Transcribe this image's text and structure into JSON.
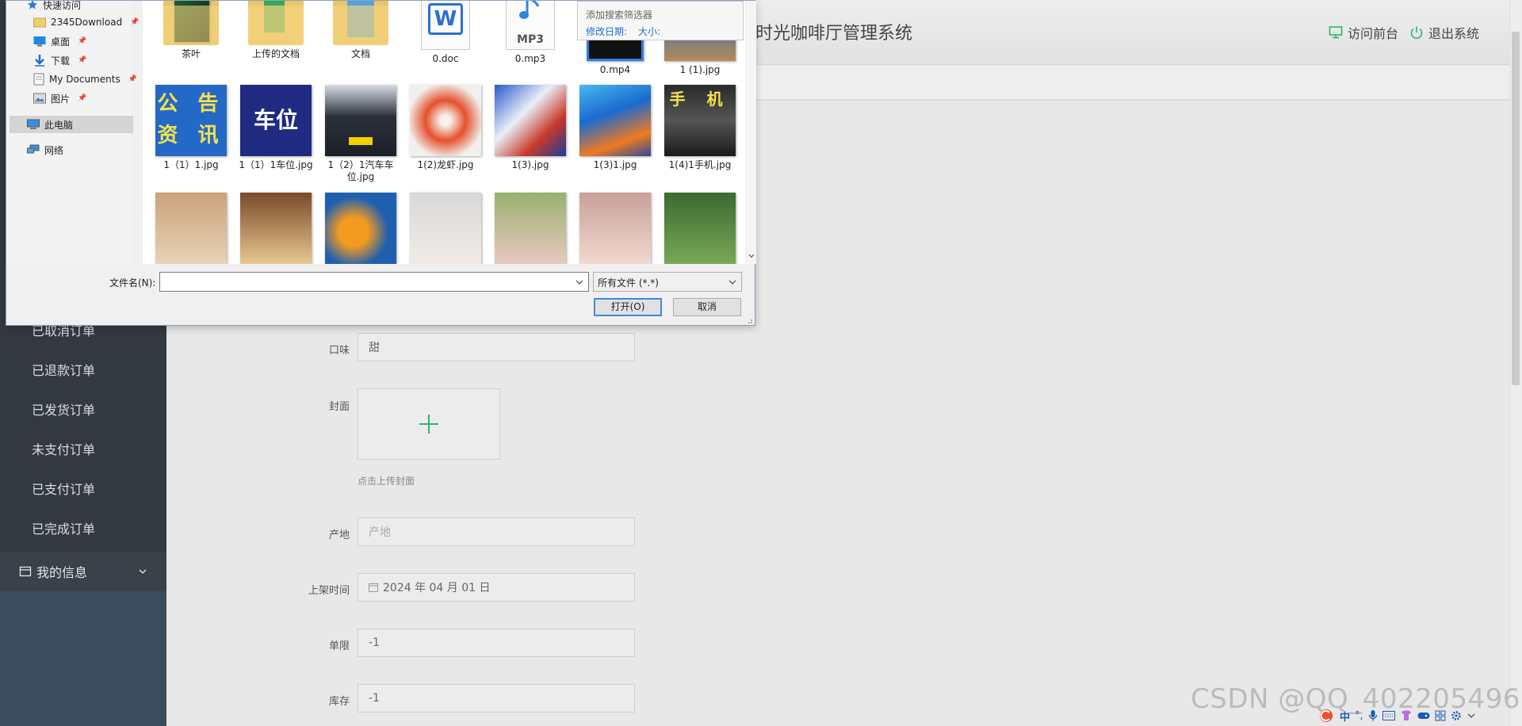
{
  "app": {
    "title": "时光咖啡厅管理系统",
    "visit_front": "访问前台",
    "logout": "退出系统"
  },
  "sidebar": {
    "items": [
      "已取消订单",
      "已退款订单",
      "已发货订单",
      "未支付订单",
      "已支付订单",
      "已完成订单"
    ],
    "group": "我的信息"
  },
  "form": {
    "taste": {
      "label": "口味",
      "value": "甜"
    },
    "cover": {
      "label": "封面",
      "hint": "点击上传封面"
    },
    "origin": {
      "label": "产地",
      "placeholder": "产地"
    },
    "shelf_time": {
      "label": "上架时间",
      "value": "2024 年 04 月 01 日"
    },
    "limit": {
      "label": "单限",
      "value": "-1"
    },
    "stock": {
      "label": "库存",
      "value": "-1"
    }
  },
  "dialog": {
    "nav": [
      {
        "label": "快速访问",
        "icon": "star-icon",
        "pinned": false
      },
      {
        "label": "2345Download",
        "icon": "folder-icon",
        "pinned": true
      },
      {
        "label": "桌面",
        "icon": "desktop-icon",
        "pinned": true
      },
      {
        "label": "下载",
        "icon": "download-icon",
        "pinned": true
      },
      {
        "label": "My Documents",
        "icon": "document-icon",
        "pinned": true
      },
      {
        "label": "图片",
        "icon": "pictures-icon",
        "pinned": true
      },
      {
        "label": "此电脑",
        "icon": "computer-icon",
        "pinned": false
      },
      {
        "label": "网络",
        "icon": "network-icon",
        "pinned": false
      }
    ],
    "files_row1": [
      "茶叶",
      "上传的文档",
      "文档",
      "0.doc",
      "0.mp3",
      "0.mp4",
      "1 (1).jpg"
    ],
    "files_row2": [
      "1（1）1.jpg",
      "1（1）1车位.jpg",
      "1（2）1汽车车位.jpg",
      "1(2)龙虾.jpg",
      "1(3).jpg",
      "1(3)1.jpg",
      "1(4)1手机.jpg"
    ],
    "thumb_text": {
      "notice": "公 告 资 讯",
      "parking": "车位",
      "phone": "手 机",
      "mp3": "MP3",
      "doc": "W"
    },
    "tooltip": {
      "filter": "添加搜索筛选器",
      "modified": "修改日期:",
      "size": "大小:"
    },
    "filename_label": "文件名(N):",
    "filetype": "所有文件 (*.*)",
    "open": "打开(O)",
    "cancel": "取消"
  },
  "watermark": "CSDN @QQ_402205496",
  "tray": {
    "ime": "中"
  },
  "colors": {
    "sidebar": "#33393f",
    "accent_green": "#2bb673",
    "dialog_border": "#8aa2c0"
  }
}
